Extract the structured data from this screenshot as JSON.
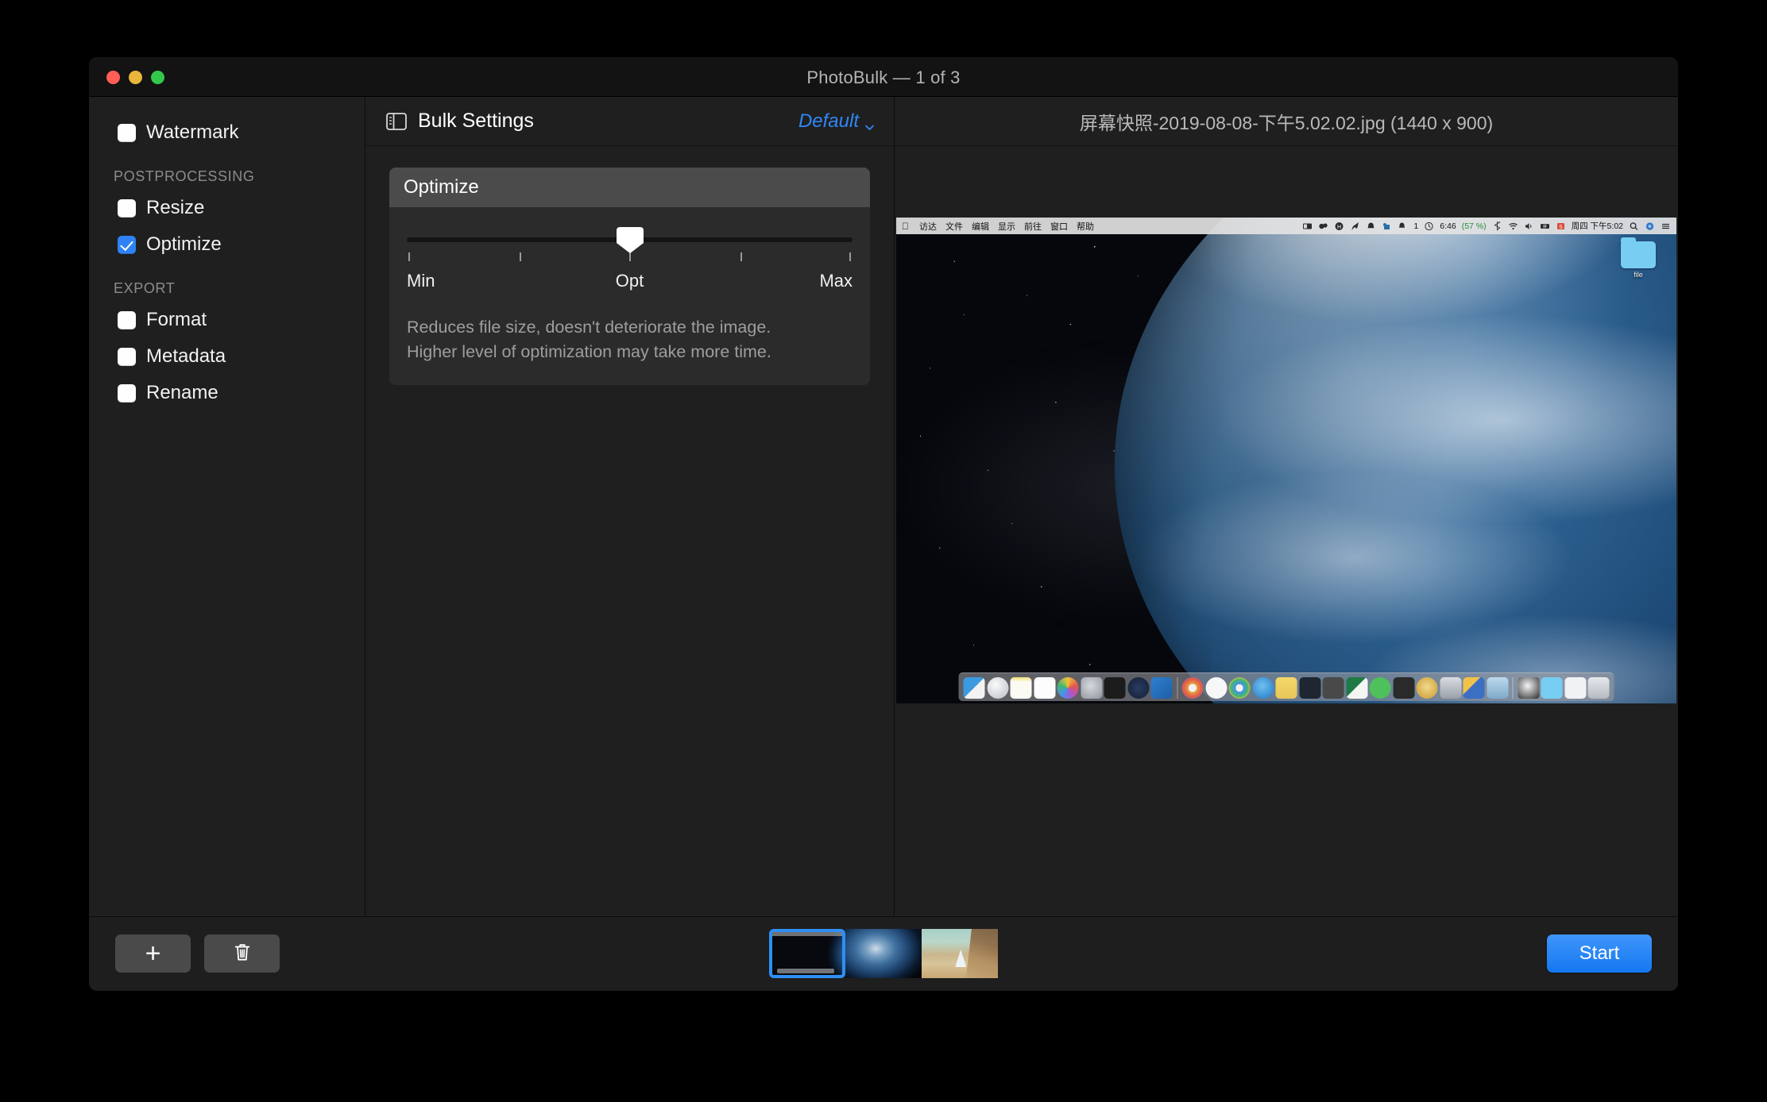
{
  "window": {
    "title": "PhotoBulk — 1 of 3",
    "traffic_lights": [
      "close-button",
      "minimize-button",
      "zoom-button"
    ]
  },
  "sidebar": {
    "items": [
      {
        "label": "Watermark",
        "checked": false
      },
      {
        "label": "Resize",
        "checked": false
      },
      {
        "label": "Optimize",
        "checked": true
      },
      {
        "label": "Format",
        "checked": false
      },
      {
        "label": "Metadata",
        "checked": false
      },
      {
        "label": "Rename",
        "checked": false
      }
    ],
    "groups": [
      {
        "label": "POSTPROCESSING"
      },
      {
        "label": "EXPORT"
      }
    ]
  },
  "settings": {
    "header_title": "Bulk Settings",
    "preset_label": "Default",
    "panel": {
      "title": "Optimize",
      "slider": {
        "min_label": "Min",
        "mid_label": "Opt",
        "max_label": "Max",
        "value_percent": 50,
        "tick_positions": [
          0,
          25,
          50,
          75,
          100
        ]
      },
      "description_line1": "Reduces file size, doesn't deteriorate the image.",
      "description_line2": "Higher level of optimization may take more time."
    }
  },
  "preview": {
    "filename": "屏幕快照-2019-08-08-下午5.02.02.jpg (1440 x 900)",
    "screenshot": {
      "menubar": {
        "apple": "",
        "menus": [
          "访达",
          "文件",
          "编辑",
          "显示",
          "前往",
          "窗口",
          "帮助"
        ],
        "status_icons": [
          "screen-icon",
          "dropbox-icon",
          "h-circle-icon",
          "rocket-icon",
          "bell-icon",
          "evernote-icon",
          "bell-count-icon"
        ],
        "notification_count": "1",
        "battery_text": "6:46",
        "battery_percent": "(57 %)",
        "right_icons": [
          "bluetooth-icon",
          "wifi-icon",
          "volume-icon",
          "input-source-icon",
          "sogou-icon"
        ],
        "clock": "周四 下午5:02",
        "trailing_icons": [
          "search-icon",
          "siri-icon",
          "notification-center-icon"
        ]
      },
      "desktop_icons": [
        {
          "name": "file",
          "type": "folder"
        }
      ],
      "dock": {
        "left_apps": [
          "finder",
          "launchpad",
          "notes",
          "reminders",
          "photos",
          "system-preferences",
          "terminal",
          "ubuntu",
          "vscode"
        ],
        "right_apps": [
          "chrome-canary",
          "qq",
          "chrome",
          "thunder",
          "stickies",
          "activity-monitor",
          "sublime",
          "excel",
          "wechat",
          "code-editor",
          "navicat",
          "virtual-machine",
          "truck",
          "preview"
        ],
        "trash_group": [
          "disk",
          "downloads-folder",
          "documents-folder",
          "trash"
        ]
      }
    }
  },
  "bottom_bar": {
    "add_button_label": "+",
    "add_button_icon": "plus-icon",
    "delete_button_icon": "trash-icon",
    "start_button_label": "Start",
    "thumbnails": [
      {
        "id": "thumb-1",
        "selected": true
      },
      {
        "id": "thumb-2",
        "selected": false
      },
      {
        "id": "thumb-3",
        "selected": false
      }
    ]
  },
  "colors": {
    "accent": "#2f87f8",
    "start_button": "#1477f0",
    "checkbox_checked": "#2f82f5",
    "window_bg": "#1f1f1f",
    "titlebar_bg": "#131313",
    "panel_header": "#4b4b4b"
  }
}
